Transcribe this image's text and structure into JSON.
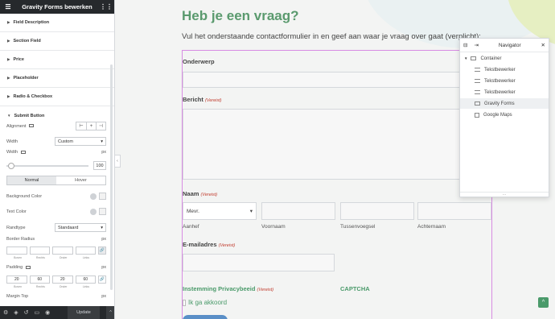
{
  "sidebar": {
    "title": "Gravity Forms bewerken",
    "sections": [
      "Field Description",
      "Section Field",
      "Price",
      "Placeholder",
      "Radio & Checkbox",
      "Submit Button"
    ],
    "submit": {
      "alignment_label": "Alignment",
      "width_label": "Width",
      "width_value": "Custom",
      "unit": "px",
      "width_number": "100",
      "tabs": [
        "Normal",
        "Hover"
      ],
      "bg_color_label": "Background Color",
      "text_color_label": "Text Color",
      "border_type_label": "Randtype",
      "border_type_value": "Standaard",
      "border_radius_label": "Border Radius",
      "sides": [
        "Boven",
        "Rechts",
        "Onder",
        "Links"
      ],
      "padding_label": "Padding",
      "padding": [
        "20",
        "60",
        "20",
        "60"
      ],
      "margin_top_label": "Margin Top"
    },
    "update_label": "Update"
  },
  "page": {
    "heading": "Heb je een vraag?",
    "intro": "Vul het onderstaande contactformulier in en geef aan waar je vraag over gaat (verplicht):",
    "form": {
      "subject_label": "Onderwerp",
      "message_label": "Bericht",
      "required": "(Vereist)",
      "name_label": "Naam",
      "salutation_value": "Mevr.",
      "name_subs": [
        "Aanhef",
        "Voornaam",
        "Tussenvoegsel",
        "Achternaam"
      ],
      "email_label": "E-mailadres",
      "consent_label": "Instemming Privacybeeid",
      "captcha_label": "CAPTCHA",
      "consent_text": "Ik ga akkoord"
    }
  },
  "navigator": {
    "title": "Navigator",
    "items": [
      "Container",
      "Tekstbewerker",
      "Tekstbewerker",
      "Tekstbewerker",
      "Gravity Forms",
      "Google Maps"
    ]
  },
  "colors": {
    "accent_green": "#4a9a6a",
    "sidebar_dark": "#26292c",
    "form_outline": "#d88ce3",
    "required_red": "#c0392b"
  }
}
